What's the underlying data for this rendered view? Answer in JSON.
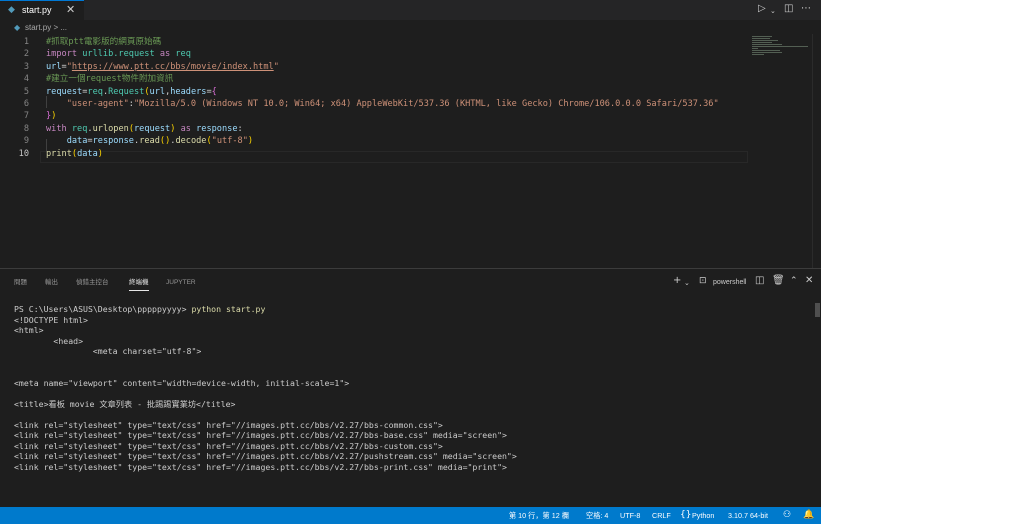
{
  "tab": {
    "filename": "start.py",
    "close_glyph": "✕"
  },
  "toolbar": {
    "run_icon": "play-icon",
    "split_icon": "split-editor-icon",
    "more_icon": "more-icon"
  },
  "breadcrumb": {
    "text": "start.py > ..."
  },
  "editor": {
    "active_line": 10,
    "lines": [
      [
        {
          "c": "c",
          "t": "#抓取ptt電影版的網頁原始碼"
        }
      ],
      [
        {
          "c": "k",
          "t": "import "
        },
        {
          "c": "t",
          "t": "urllib.request"
        },
        {
          "c": "k",
          "t": " as "
        },
        {
          "c": "t",
          "t": "req"
        }
      ],
      [
        {
          "c": "v",
          "t": "url"
        },
        {
          "c": "p",
          "t": "="
        },
        {
          "c": "s",
          "t": "\""
        },
        {
          "c": "s u",
          "t": "https://www.ptt.cc/bbs/movie/index.html"
        },
        {
          "c": "s",
          "t": "\""
        }
      ],
      [
        {
          "c": "c",
          "t": "#建立一個request物件附加資訊"
        }
      ],
      [
        {
          "c": "v",
          "t": "request"
        },
        {
          "c": "p",
          "t": "="
        },
        {
          "c": "t",
          "t": "req"
        },
        {
          "c": "p",
          "t": "."
        },
        {
          "c": "t",
          "t": "Request"
        },
        {
          "c": "b1",
          "t": "("
        },
        {
          "c": "v",
          "t": "url"
        },
        {
          "c": "p",
          "t": ","
        },
        {
          "c": "v",
          "t": "headers"
        },
        {
          "c": "p",
          "t": "="
        },
        {
          "c": "b2",
          "t": "{"
        }
      ],
      [
        {
          "c": "p",
          "t": "    "
        },
        {
          "c": "s",
          "t": "\"user-agent\""
        },
        {
          "c": "p",
          "t": ":"
        },
        {
          "c": "s",
          "t": "\"Mozilla/5.0 (Windows NT 10.0; Win64; x64) AppleWebKit/537.36 (KHTML, like Gecko) Chrome/106.0.0.0 Safari/537.36\""
        }
      ],
      [
        {
          "c": "b2",
          "t": "}"
        },
        {
          "c": "b1",
          "t": ")"
        }
      ],
      [
        {
          "c": "k",
          "t": "with "
        },
        {
          "c": "t",
          "t": "req"
        },
        {
          "c": "p",
          "t": "."
        },
        {
          "c": "f",
          "t": "urlopen"
        },
        {
          "c": "b1",
          "t": "("
        },
        {
          "c": "v",
          "t": "request"
        },
        {
          "c": "b1",
          "t": ")"
        },
        {
          "c": "k",
          "t": " as "
        },
        {
          "c": "v",
          "t": "response"
        },
        {
          "c": "p",
          "t": ":"
        }
      ],
      [
        {
          "c": "p",
          "t": "    "
        },
        {
          "c": "v",
          "t": "data"
        },
        {
          "c": "p",
          "t": "="
        },
        {
          "c": "v",
          "t": "response"
        },
        {
          "c": "p",
          "t": "."
        },
        {
          "c": "f",
          "t": "read"
        },
        {
          "c": "b1",
          "t": "()"
        },
        {
          "c": "p",
          "t": "."
        },
        {
          "c": "f",
          "t": "decode"
        },
        {
          "c": "b1",
          "t": "("
        },
        {
          "c": "s",
          "t": "\"utf-8\""
        },
        {
          "c": "b1",
          "t": ")"
        }
      ],
      [
        {
          "c": "f",
          "t": "print"
        },
        {
          "c": "b1",
          "t": "("
        },
        {
          "c": "v",
          "t": "data"
        },
        {
          "c": "b1",
          "t": ")"
        }
      ]
    ]
  },
  "panel": {
    "tabs": [
      "問題",
      "輸出",
      "偵錯主控台",
      "終端機",
      "JUPYTER"
    ],
    "active_tab": "終端機",
    "shell_label": "powershell",
    "terminal": [
      {
        "prompt": "PS C:\\Users\\ASUS\\Desktop\\pppppyyyy> ",
        "command": "python start.py"
      },
      "<!DOCTYPE html>",
      "<html>",
      "        <head>",
      "                <meta charset=\"utf-8\">",
      "",
      "",
      "<meta name=\"viewport\" content=\"width=device-width, initial-scale=1\">",
      "",
      "<title>看板 movie 文章列表 - 批踢踢實業坊</title>",
      "",
      "<link rel=\"stylesheet\" type=\"text/css\" href=\"//images.ptt.cc/bbs/v2.27/bbs-common.css\">",
      "<link rel=\"stylesheet\" type=\"text/css\" href=\"//images.ptt.cc/bbs/v2.27/bbs-base.css\" media=\"screen\">",
      "<link rel=\"stylesheet\" type=\"text/css\" href=\"//images.ptt.cc/bbs/v2.27/bbs-custom.css\">",
      "<link rel=\"stylesheet\" type=\"text/css\" href=\"//images.ptt.cc/bbs/v2.27/pushstream.css\" media=\"screen\">",
      "<link rel=\"stylesheet\" type=\"text/css\" href=\"//images.ptt.cc/bbs/v2.27/bbs-print.css\" media=\"print\">"
    ]
  },
  "statusbar": {
    "position": "第 10 行，第 12 欄",
    "spaces": "空格: 4",
    "encoding": "UTF-8",
    "eol": "CRLF",
    "language": "Python",
    "interpreter": "3.10.7 64-bit"
  },
  "colors": {
    "accent": "#007acc",
    "editor_bg": "#1e1e1e",
    "tabbar_bg": "#252526"
  }
}
